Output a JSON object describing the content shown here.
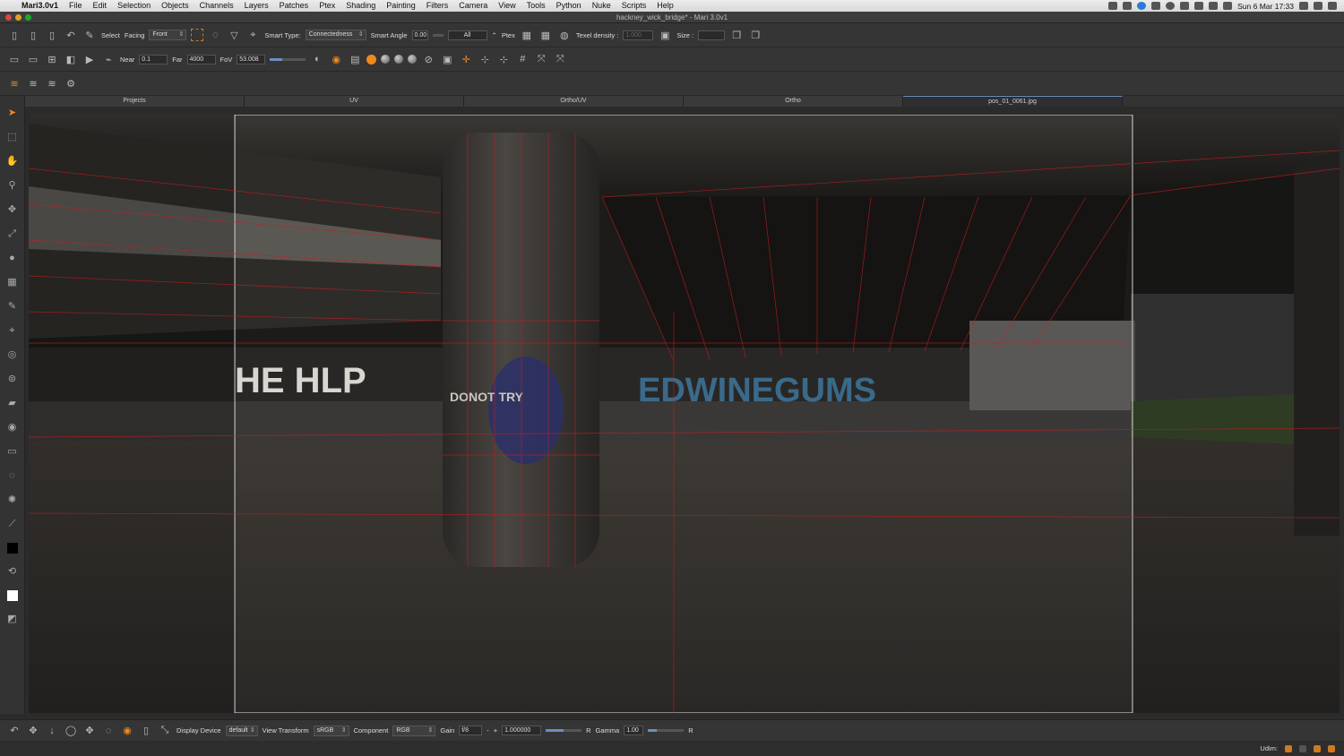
{
  "menubar": {
    "app": "Mari3.0v1",
    "items": [
      "File",
      "Edit",
      "Selection",
      "Objects",
      "Channels",
      "Layers",
      "Patches",
      "Ptex",
      "Shading",
      "Painting",
      "Filters",
      "Camera",
      "View",
      "Tools",
      "Python",
      "Nuke",
      "Scripts",
      "Help"
    ],
    "clock": "Sun 6 Mar  17:33"
  },
  "window": {
    "title": "hackney_wick_bridge* - Mari 3.0v1"
  },
  "toolbar1": {
    "select_label": "Select",
    "facing_label": "Facing",
    "facing_value": "Front",
    "smart_type_label": "Smart Type:",
    "smart_type_value": "Connectedness",
    "smart_angle_label": "Smart Angle",
    "smart_angle_value": "0.00",
    "all_value": "All",
    "ptex_label": "Ptex",
    "texel_density_label": "Texel density :",
    "texel_density_value": "1.000",
    "size_label": "Size :",
    "size_value": ""
  },
  "toolbar2": {
    "near_label": "Near",
    "near_value": "0.1",
    "far_label": "Far",
    "far_value": "4000",
    "fov_label": "FoV",
    "fov_value": "53.008",
    "fov_slider": 0.35
  },
  "tabs": [
    "Projects",
    "UV",
    "Ortho/UV",
    "Ortho",
    "pos_01_0061.jpg"
  ],
  "active_tab": "pos_01_0061.jpg",
  "viewport": {
    "graffiti_left": "HE HLP",
    "graffiti_center": "EDWINEGUMS",
    "graffiti_pillar": "DONOT TRY"
  },
  "bottombar": {
    "display_device_label": "Display Device",
    "display_device_value": "default",
    "view_transform_label": "View Transform",
    "view_transform_value": "sRGB",
    "component_label": "Component",
    "component_value": "RGB",
    "gain_label": "Gain",
    "gain_value": "f/8",
    "minus": "-",
    "plus": "+",
    "exposure_value": "1.000000",
    "exposure_slider": 0.5,
    "channel_r1": "R",
    "gamma_label": "Gamma",
    "gamma_value": "1.00",
    "gamma_slider": 0.25,
    "channel_r2": "R"
  },
  "statusbar": {
    "udim_label": "Udim:"
  },
  "colors": {
    "accent": "#f08a1e",
    "wire": "#c81e1e",
    "active_tab_line": "#6a8fc0"
  }
}
